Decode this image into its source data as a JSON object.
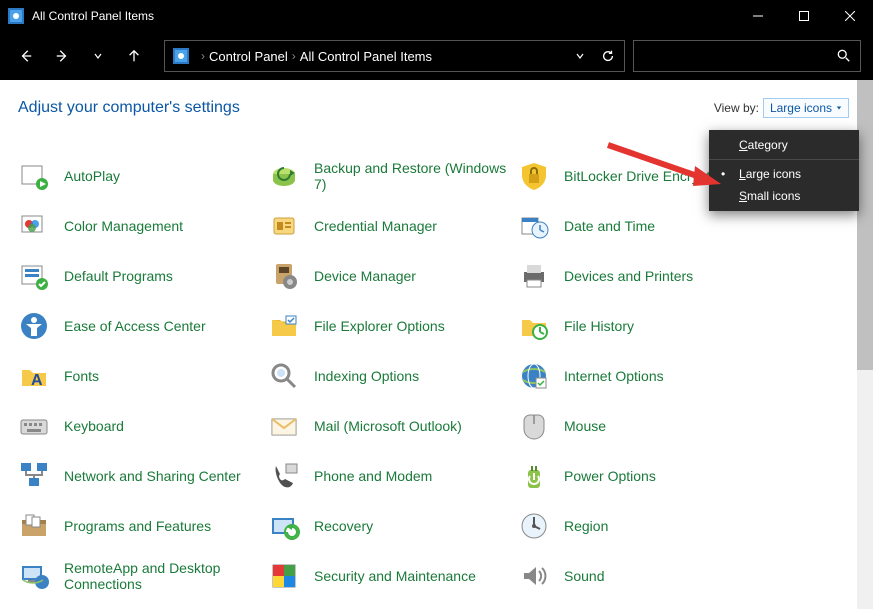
{
  "window": {
    "title": "All Control Panel Items"
  },
  "breadcrumb": {
    "seg1": "Control Panel",
    "seg2": "All Control Panel Items"
  },
  "header": {
    "settings_title": "Adjust your computer's settings",
    "viewby_label": "View by:",
    "viewby_value": "Large icons"
  },
  "viewby_menu": {
    "category": "ategory",
    "large": "arge icons",
    "small": "mall icons"
  },
  "items": [
    {
      "label": "AutoPlay"
    },
    {
      "label": "Backup and Restore (Windows 7)"
    },
    {
      "label": "BitLocker Drive Encryption"
    },
    {
      "label": "Color Management"
    },
    {
      "label": "Credential Manager"
    },
    {
      "label": "Date and Time"
    },
    {
      "label": "Default Programs"
    },
    {
      "label": "Device Manager"
    },
    {
      "label": "Devices and Printers"
    },
    {
      "label": "Ease of Access Center"
    },
    {
      "label": "File Explorer Options"
    },
    {
      "label": "File History"
    },
    {
      "label": "Fonts"
    },
    {
      "label": "Indexing Options"
    },
    {
      "label": "Internet Options"
    },
    {
      "label": "Keyboard"
    },
    {
      "label": "Mail (Microsoft Outlook)"
    },
    {
      "label": "Mouse"
    },
    {
      "label": "Network and Sharing Center"
    },
    {
      "label": "Phone and Modem"
    },
    {
      "label": "Power Options"
    },
    {
      "label": "Programs and Features"
    },
    {
      "label": "Recovery"
    },
    {
      "label": "Region"
    },
    {
      "label": "RemoteApp and Desktop Connections"
    },
    {
      "label": "Security and Maintenance"
    },
    {
      "label": "Sound"
    }
  ],
  "icons": [
    "autoplay",
    "backup",
    "bitlocker",
    "color",
    "credential",
    "datetime",
    "defaultprog",
    "devicemgr",
    "printers",
    "ease",
    "explorer",
    "filehistory",
    "fonts",
    "indexing",
    "internet",
    "keyboard",
    "mail",
    "mouse",
    "network",
    "phone",
    "power",
    "programs",
    "recovery",
    "region",
    "remote",
    "security",
    "sound"
  ],
  "colors": {
    "link_green": "#1a7a3a",
    "header_blue": "#0b57a5",
    "menu_bg": "#2b2b2b",
    "arrow_red": "#e3342f"
  }
}
